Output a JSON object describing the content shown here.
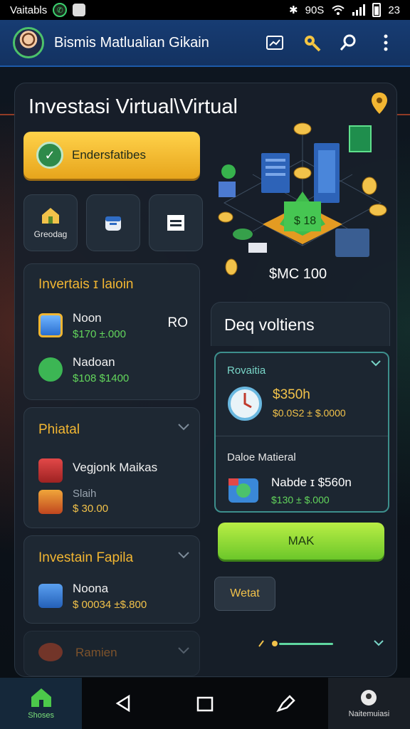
{
  "status_bar": {
    "left_text": "Vaitabls",
    "time": "23"
  },
  "app_bar": {
    "title": "Bismis Matlualian Gikain"
  },
  "page": {
    "title": "Investasi Virtual\\Virtual"
  },
  "cta": {
    "label": "Endersfatibes"
  },
  "tiles": [
    {
      "label": "Greodag"
    }
  ],
  "illustration": {
    "amount": "$MC 100"
  },
  "investasi_card": {
    "title": "Invertais ɪ laioin",
    "side_value": "RO",
    "items": [
      {
        "name": "Noon",
        "value": "$170 ±.000"
      },
      {
        "name": "Nadoan",
        "value": "$108 $1400"
      }
    ]
  },
  "phiatal_card": {
    "title": "Phiatal",
    "items": [
      {
        "name": "Vegjonk Maikas",
        "value": ""
      },
      {
        "name": "Slaih",
        "value": "$ 30.00"
      }
    ]
  },
  "tapila_card": {
    "title": "Investain Fapila",
    "items": [
      {
        "name": "Noona",
        "value": "$ 00034 ±$.800"
      }
    ]
  },
  "ramien_card": {
    "title": "Ramien"
  },
  "right_section": {
    "header": "Deq voltiens",
    "subheader": "Rovaitia",
    "clock_amount": "$350h",
    "clock_range": "$0.0Ѕ2 ± $.0000",
    "section_title": "Daloe Matieral",
    "item_name": "Nabde ɪ $560n",
    "item_value": "$130 ± $.000",
    "mark_button": "MAK",
    "watch_button": "Wetat"
  },
  "bottom_nav": {
    "home_label": "Shoses",
    "right_label": "Naitemuiasi"
  }
}
